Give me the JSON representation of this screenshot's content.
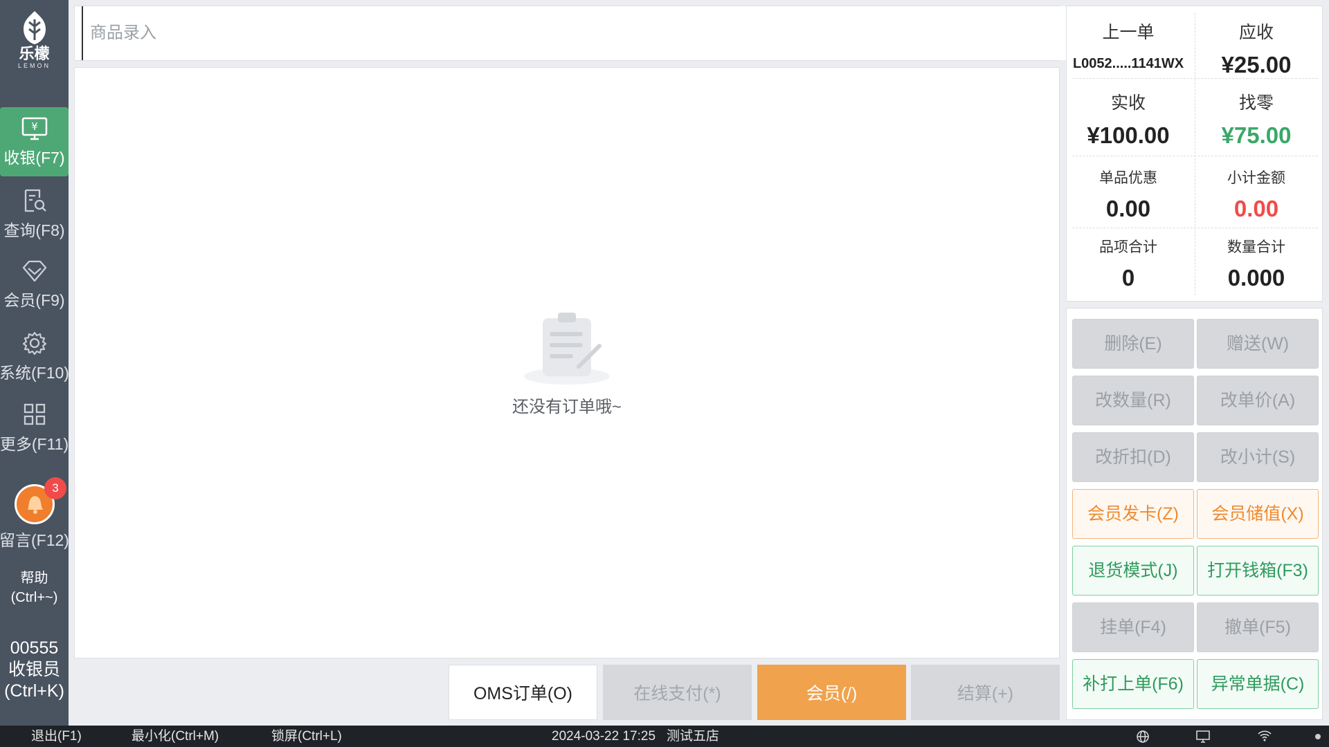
{
  "sidebar": {
    "brand": "乐檬",
    "brand_en": "LEMON",
    "items": [
      {
        "label": "收银(F7)",
        "icon": "cashier-icon"
      },
      {
        "label": "查询(F8)",
        "icon": "search-doc-icon"
      },
      {
        "label": "会员(F9)",
        "icon": "diamond-icon"
      },
      {
        "label": "系统(F10)",
        "icon": "gear-icon"
      },
      {
        "label": "更多(F11)",
        "icon": "grid-icon"
      }
    ],
    "messages": {
      "label": "留言(F12)",
      "badge": "3",
      "icon": "bell-icon"
    },
    "help": {
      "line1": "帮助",
      "line2": "(Ctrl+~)"
    },
    "user": {
      "id": "00555",
      "role": "收银员",
      "shortcut": "(Ctrl+K)"
    }
  },
  "search": {
    "placeholder": "商品录入",
    "value": ""
  },
  "order": {
    "empty_text": "还没有订单哦~"
  },
  "actions": {
    "oms": "OMS订单(O)",
    "online_pay": "在线支付(*)",
    "member": "会员(/)",
    "checkout": "结算(+)"
  },
  "summary": {
    "last_order_label": "上一单",
    "last_order_value": "L0052.....1141WX",
    "receivable_label": "应收",
    "receivable_value": "¥25.00",
    "received_label": "实收",
    "received_value": "¥100.00",
    "change_label": "找零",
    "change_value": "¥75.00",
    "item_discount_label": "单品优惠",
    "item_discount_value": "0.00",
    "subtotal_label": "小计金额",
    "subtotal_value": "0.00",
    "line_count_label": "品项合计",
    "line_count_value": "0",
    "qty_total_label": "数量合计",
    "qty_total_value": "0.000"
  },
  "functions": {
    "delete": "删除(E)",
    "gift": "赠送(W)",
    "change_qty": "改数量(R)",
    "change_price": "改单价(A)",
    "change_discount": "改折扣(D)",
    "change_subtotal": "改小计(S)",
    "member_card": "会员发卡(Z)",
    "member_deposit": "会员储值(X)",
    "return_mode": "退货模式(J)",
    "open_drawer": "打开钱箱(F3)",
    "hold": "挂单(F4)",
    "cancel": "撤单(F5)",
    "reprint": "补打上单(F6)",
    "exception": "异常单据(C)"
  },
  "statusbar": {
    "exit": "退出(F1)",
    "minimize": "最小化(Ctrl+M)",
    "lock": "锁屏(Ctrl+L)",
    "datetime": "2024-03-22 17:25",
    "store": "测试五店"
  },
  "colors": {
    "sidebar": "#4a5360",
    "active": "#4ea876",
    "member_button": "#f0a24c",
    "change_amount": "#3aa868",
    "subtotal_red": "#f04b4b"
  }
}
